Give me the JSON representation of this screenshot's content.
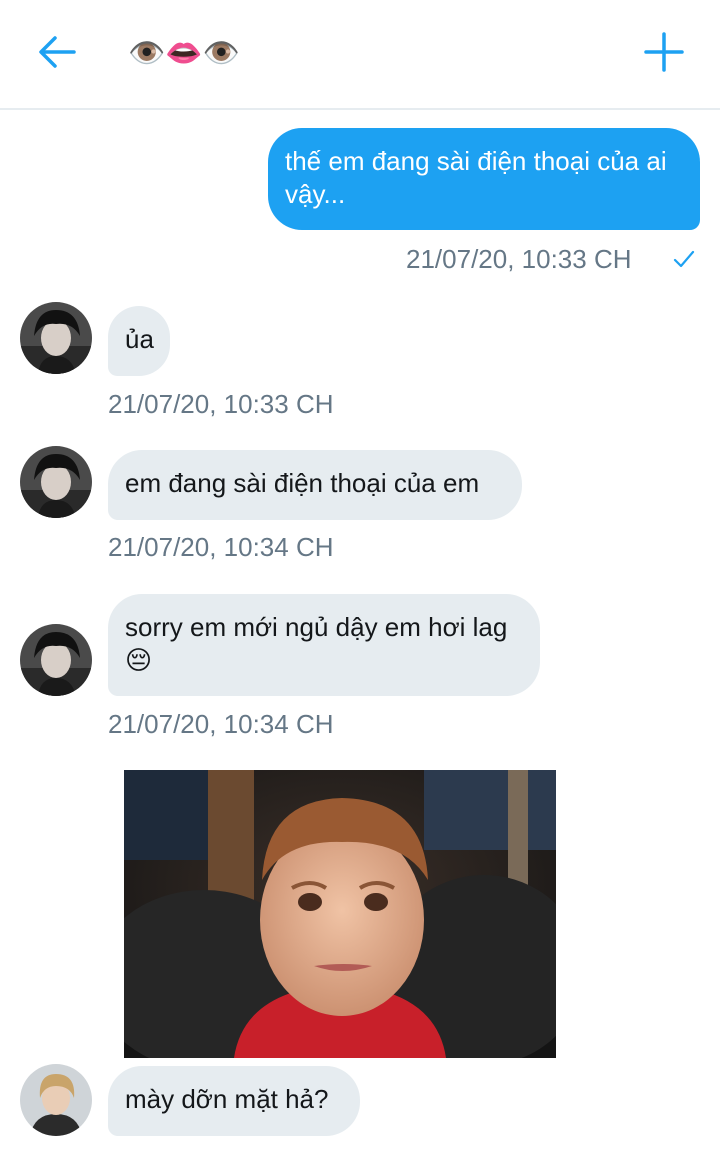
{
  "header": {
    "title": "👁️👄👁️",
    "back_icon": "arrow-left-icon",
    "new_icon": "plus-icon",
    "accent": "#1da1f2"
  },
  "messages": [
    {
      "direction": "out",
      "text": "thế em đang sài điện thoại của ai vậy...",
      "timestamp": "21/07/20, 10:33 CH",
      "status_icon": "checkmark-icon"
    },
    {
      "direction": "in",
      "text": "ủa",
      "timestamp": "21/07/20, 10:33 CH"
    },
    {
      "direction": "in",
      "text": "em đang sài điện thoại của em",
      "timestamp": "21/07/20, 10:34 CH"
    },
    {
      "direction": "in",
      "text": "sorry em mới ngủ dậy em hơi lag 😔",
      "timestamp": "21/07/20, 10:34 CH"
    },
    {
      "direction": "out",
      "type": "image",
      "alt": ""
    },
    {
      "direction": "in",
      "text": "mày dỡn mặt hả?"
    }
  ],
  "colors": {
    "outgoing_bubble": "#1da1f2",
    "incoming_bubble": "#e6ecf0",
    "timestamp": "#657786"
  }
}
